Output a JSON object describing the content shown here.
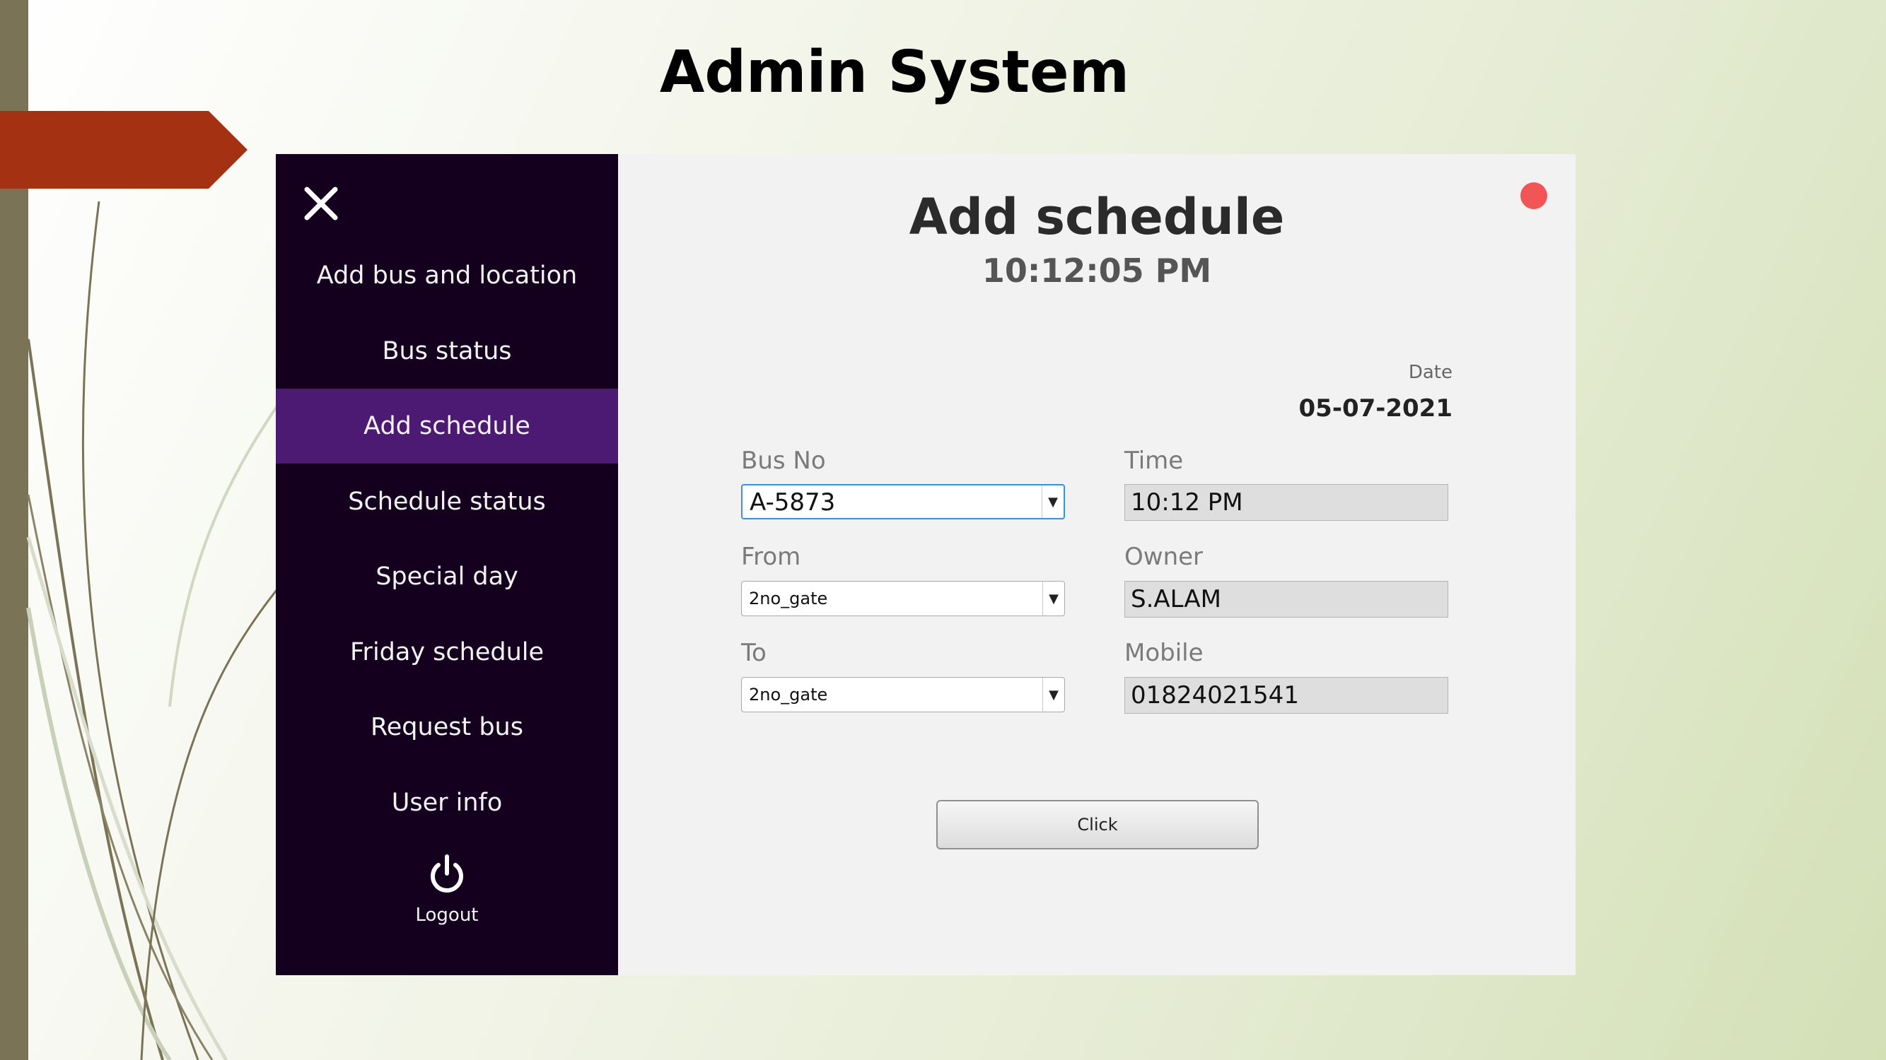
{
  "slide": {
    "title": "Admin System"
  },
  "sidebar": {
    "close_icon": "close-icon",
    "items": [
      {
        "label": "Add bus and location",
        "active": false
      },
      {
        "label": "Bus status",
        "active": false
      },
      {
        "label": "Add schedule",
        "active": true
      },
      {
        "label": "Schedule status",
        "active": false
      },
      {
        "label": "Special day",
        "active": false
      },
      {
        "label": "Friday schedule",
        "active": false
      },
      {
        "label": "Request bus",
        "active": false
      },
      {
        "label": "User info",
        "active": false
      }
    ],
    "logout": {
      "icon": "power-icon",
      "label": "Logout"
    }
  },
  "form": {
    "title": "Add schedule",
    "clock": "10:12:05 PM",
    "date_label": "Date",
    "date_value": "05-07-2021",
    "bus_no": {
      "label": "Bus No",
      "value": "A-5873"
    },
    "from": {
      "label": "From",
      "value": "2no_gate"
    },
    "to": {
      "label": "To",
      "value": "2no_gate"
    },
    "time": {
      "label": "Time",
      "value": "10:12 PM"
    },
    "owner": {
      "label": "Owner",
      "value": "S.ALAM"
    },
    "mobile": {
      "label": "Mobile",
      "value": "01824021541"
    },
    "submit_label": "Click"
  },
  "colors": {
    "sidebar_bg": "#14001e",
    "sidebar_active": "#4d1a73",
    "banner": "#a33112",
    "status_dot": "#f35456"
  }
}
